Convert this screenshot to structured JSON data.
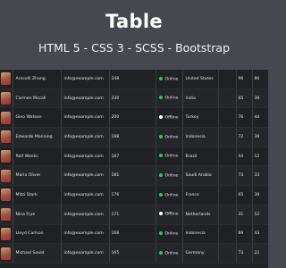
{
  "header": {
    "title": "Table",
    "subtitle": "HTML 5 - CSS 3 - SCSS - Bootstrap"
  },
  "colors": {
    "background": "#45494f",
    "table_bg": "#1f2125",
    "online": "#2ecc40",
    "offline": "#ffffff"
  },
  "rows": [
    {
      "name": "Aracelli Zhang",
      "email": "info@example.com",
      "num": "248",
      "status": "Online",
      "country": "United States",
      "a": "96",
      "b": "86"
    },
    {
      "name": "Carmen Mccall",
      "email": "info@example.com",
      "num": "230",
      "status": "Online",
      "country": "India",
      "a": "65",
      "b": "39"
    },
    {
      "name": "Gino Watson",
      "email": "info@example.com",
      "num": "200",
      "status": "Offline",
      "country": "Turkey",
      "a": "76",
      "b": "44"
    },
    {
      "name": "Edwardo Manning",
      "email": "info@example.com",
      "num": "198",
      "status": "Online",
      "country": "Indonesia",
      "a": "72",
      "b": "39"
    },
    {
      "name": "Rolf Weeks",
      "email": "info@example.com",
      "num": "187",
      "status": "Online",
      "country": "Brazil",
      "a": "44",
      "b": "12"
    },
    {
      "name": "Maria Oliver",
      "email": "info@example.com",
      "num": "181",
      "status": "Online",
      "country": "Saudi Arabia",
      "a": "73",
      "b": "33"
    },
    {
      "name": "Mitzi Stark",
      "email": "info@example.com",
      "num": "176",
      "status": "Online",
      "country": "France",
      "a": "65",
      "b": "39"
    },
    {
      "name": "Nina Frye",
      "email": "info@example.com",
      "num": "171",
      "status": "Offline",
      "country": "Netherlands",
      "a": "31",
      "b": "12"
    },
    {
      "name": "Lloyd Carlson",
      "email": "info@example.com",
      "num": "168",
      "status": "Online",
      "country": "Indonesia",
      "a": "89",
      "b": "43"
    },
    {
      "name": "Michael Sould",
      "email": "info@example.com",
      "num": "165",
      "status": "Online",
      "country": "Germany",
      "a": "73",
      "b": "22"
    }
  ]
}
